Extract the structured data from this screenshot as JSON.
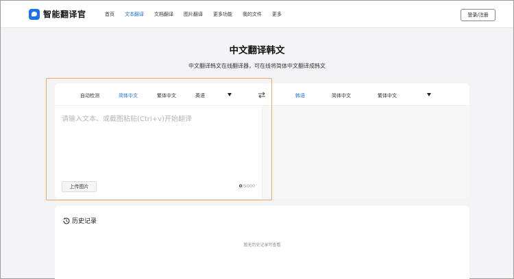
{
  "app": {
    "name": "智能翻译官"
  },
  "nav": {
    "items": [
      {
        "label": "首页"
      },
      {
        "label": "文本翻译"
      },
      {
        "label": "文档翻译"
      },
      {
        "label": "图片翻译"
      },
      {
        "label": "更多功能"
      },
      {
        "label": "我的文件"
      },
      {
        "label": "更多"
      }
    ],
    "active": "文本翻译",
    "login_label": "登录/注册"
  },
  "page": {
    "title": "中文翻译韩文",
    "subtitle": "中文翻译韩文在线翻译器，可在线将简体中文翻译成韩文"
  },
  "translator": {
    "source_langs": [
      {
        "label": "自动检测"
      },
      {
        "label": "简体中文"
      },
      {
        "label": "繁体中文"
      },
      {
        "label": "英语"
      }
    ],
    "source_active": "简体中文",
    "target_langs": [
      {
        "label": "韩语"
      },
      {
        "label": "简体中文"
      },
      {
        "label": "繁体中文"
      }
    ],
    "target_active": "韩语",
    "input_value": "",
    "input_placeholder": "请输入文本、或截图粘贴(Ctrl+v)开始翻译",
    "upload_label": "上传图片",
    "char_count": "0",
    "char_limit": "/5000"
  },
  "history": {
    "title": "历史记录",
    "empty_text": "暂无历史记录可查看"
  },
  "icons": {
    "logo": "logo-icon",
    "swap": "swap-arrows-icon",
    "dropdown": "caret-down-icon",
    "history": "history-clock-icon"
  },
  "colors": {
    "accent": "#1a73e8",
    "highlight": "#f0a35a",
    "page_bg": "#f4f4f6",
    "target_pane_bg": "#f7f7f8"
  }
}
